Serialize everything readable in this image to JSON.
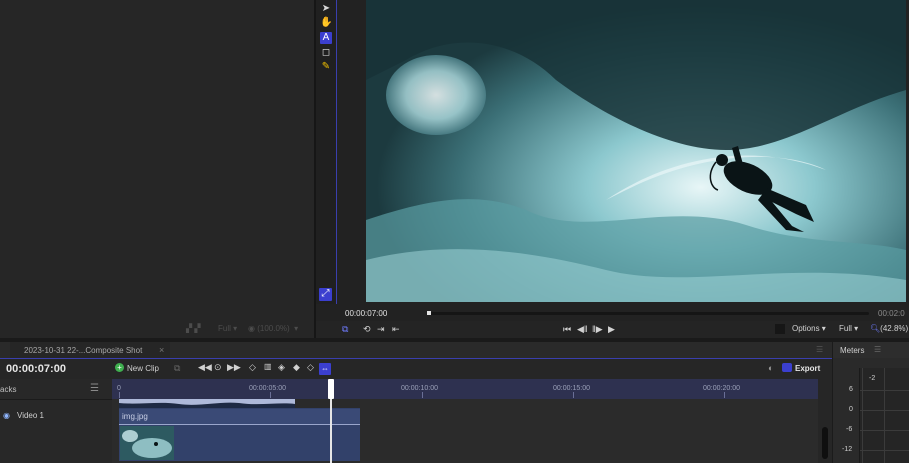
{
  "left_status": {
    "full": "Full",
    "zoom": "(100.0%)"
  },
  "tools": [
    "pointer-icon",
    "hand-icon",
    "text-icon",
    "crop-icon",
    "pen-icon"
  ],
  "viewer": {
    "timecode": "00:00:07:00",
    "end_timecode": "00:02:0"
  },
  "transport": {
    "options": "Options",
    "full": "Full",
    "zoom": "(42.8%)"
  },
  "timeline": {
    "tab": "2023-10-31 22-...Composite Shot",
    "timecode": "00:00:07:00",
    "new_clip": "New Clip",
    "export": "Export",
    "tracks_label": "acks",
    "track_name": "Video 1",
    "clip_name": "img.jpg",
    "ruler_ticks": [
      "0",
      "00:00:05:00",
      "00:00:10:00",
      "00:00:15:00",
      "00:00:20:00"
    ]
  },
  "meters": {
    "title": "Meters",
    "scale": [
      "-2",
      "6",
      "0",
      "-6",
      "-12"
    ]
  }
}
